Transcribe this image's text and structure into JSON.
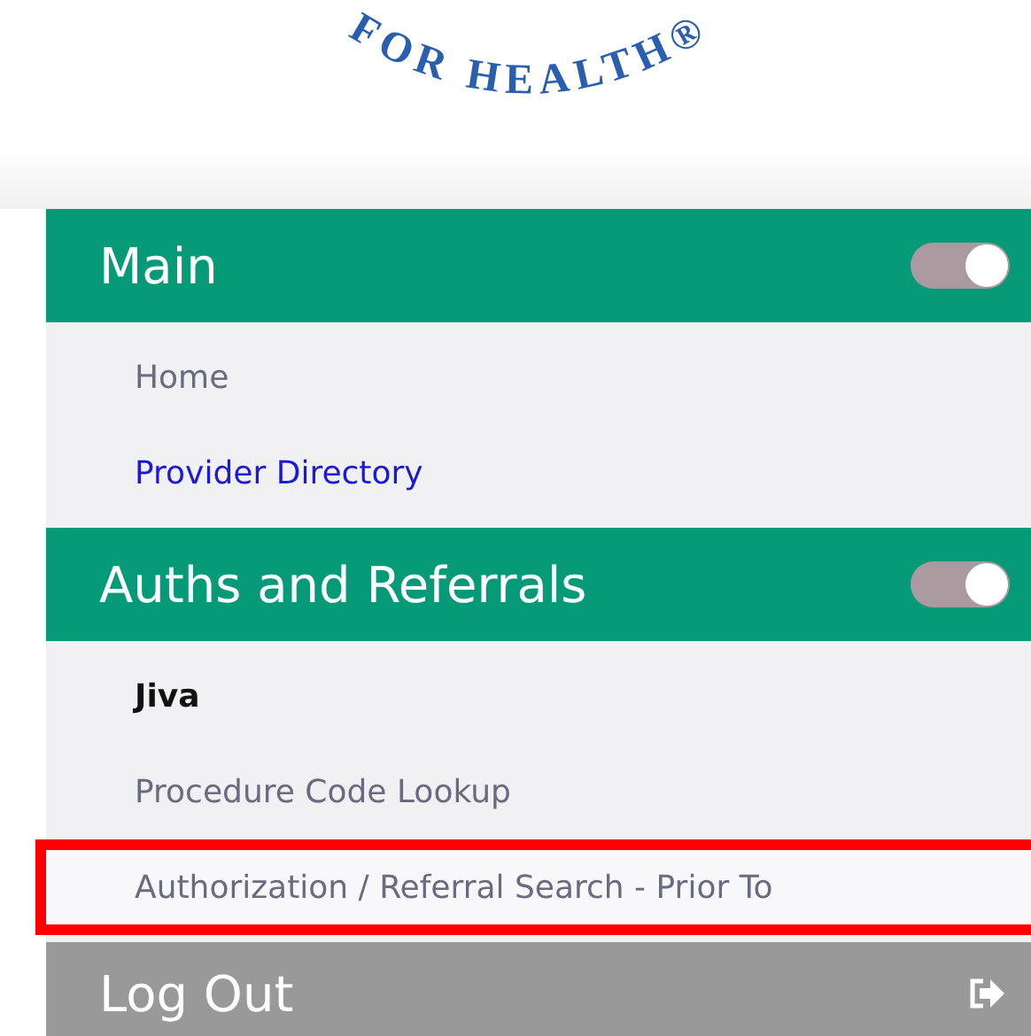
{
  "logo": {
    "text": "FOR HEALTH®"
  },
  "sections": [
    {
      "title": "Main",
      "on": true,
      "items": [
        {
          "label": "Home",
          "kind": "plain",
          "highlighted": false
        },
        {
          "label": "Provider Directory",
          "kind": "link",
          "highlighted": false
        }
      ]
    },
    {
      "title": "Auths and Referrals",
      "on": true,
      "items": [
        {
          "label": "Jiva",
          "kind": "bold",
          "highlighted": false
        },
        {
          "label": "Procedure Code Lookup",
          "kind": "plain",
          "highlighted": false
        },
        {
          "label": "Authorization / Referral Search - Prior To",
          "kind": "plain",
          "highlighted": true
        }
      ]
    }
  ],
  "logout": {
    "label": "Log Out"
  }
}
